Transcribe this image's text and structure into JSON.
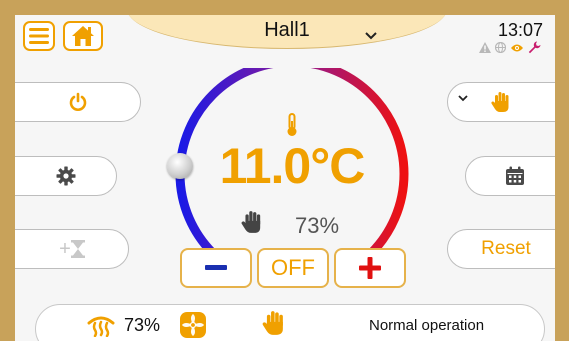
{
  "header": {
    "zone_name": "Hall1",
    "time": "13:07"
  },
  "temperature": {
    "setpoint": "11.0°C",
    "humidity": "73%"
  },
  "controls": {
    "off_label": "OFF",
    "reset_label": "Reset",
    "timer_boost_label": "+"
  },
  "status_bar": {
    "heating_output": "73%",
    "operation_mode": "Normal operation"
  },
  "colors": {
    "accent": "#f0a000",
    "cold": "#1a1ae6",
    "hot": "#ee1111",
    "frame": "#c8a25a",
    "zone_tab": "#fbe7b8"
  },
  "icons": {
    "menu": "hamburger-icon",
    "home": "home-icon",
    "power": "power-icon",
    "settings": "gear-icon",
    "timer": "hourglass-icon",
    "calendar": "calendar-icon",
    "manual": "hand-icon",
    "thermometer": "thermometer-icon",
    "fan": "fan-icon",
    "heating": "heat-icon",
    "warning": "warning-icon",
    "network": "globe-icon",
    "visibility": "eye-icon",
    "service": "wrench-icon"
  }
}
